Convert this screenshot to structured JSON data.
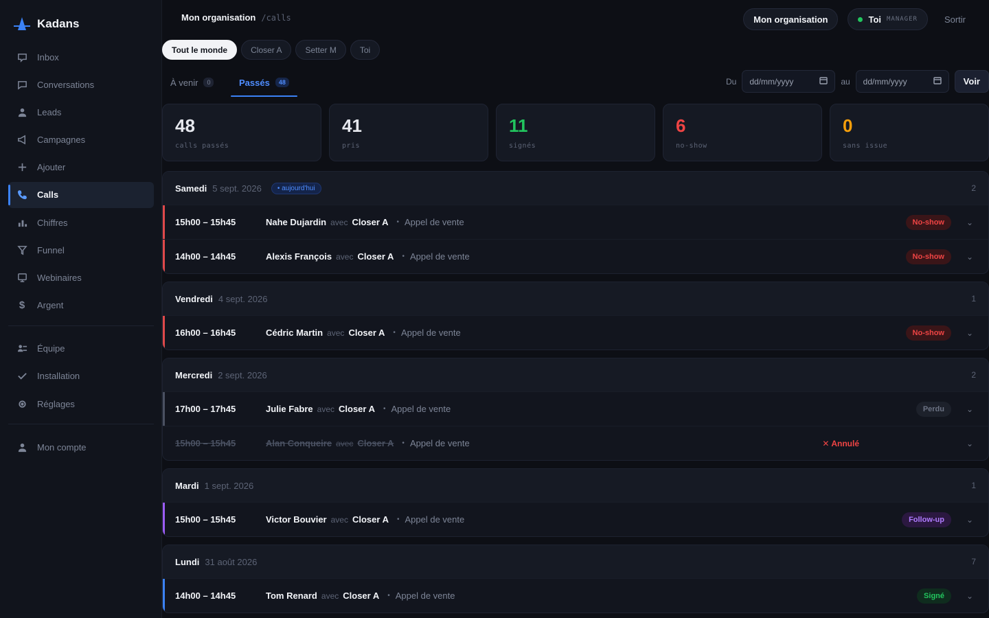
{
  "brand": {
    "name": "Kadans",
    "accent": "#3b82f6"
  },
  "sidebar": {
    "items": [
      {
        "label": "Inbox",
        "icon": "inbox-icon"
      },
      {
        "label": "Conversations",
        "icon": "chat-icon"
      },
      {
        "label": "Leads",
        "icon": "user-icon"
      },
      {
        "label": "Campagnes",
        "icon": "megaphone-icon"
      },
      {
        "label": "Ajouter",
        "icon": "plus-icon"
      },
      {
        "label": "Calls",
        "icon": "phone-icon",
        "active": true
      },
      {
        "label": "Chiffres",
        "icon": "bar-chart-icon"
      },
      {
        "label": "Funnel",
        "icon": "funnel-icon"
      },
      {
        "label": "Webinaires",
        "icon": "monitor-icon"
      },
      {
        "label": "Argent",
        "icon": "dollar-icon"
      }
    ],
    "items2": [
      {
        "label": "Équipe",
        "icon": "team-icon"
      },
      {
        "label": "Installation",
        "icon": "check-icon"
      },
      {
        "label": "Réglages",
        "icon": "gear-icon"
      }
    ],
    "account": {
      "label": "Mon compte",
      "icon": "user-icon"
    }
  },
  "header": {
    "org": "Mon organisation",
    "path": "/calls",
    "org_button": "Mon organisation",
    "user_label": "Toi",
    "user_role": "MANAGER",
    "logout": "Sortir"
  },
  "filters": [
    "Tout le monde",
    "Closer A",
    "Setter M",
    "Toi"
  ],
  "tabs": [
    {
      "label": "À venir",
      "count": "0"
    },
    {
      "label": "Passés",
      "count": "48",
      "active": true
    }
  ],
  "daterange": {
    "from_label": "Du",
    "to_label": "au",
    "placeholder": "dd/mm/yyyy",
    "button": "Voir"
  },
  "stats": [
    {
      "value": "48",
      "label": "calls passés",
      "color": "#e6e8ee"
    },
    {
      "value": "41",
      "label": "pris",
      "color": "#e6e8ee"
    },
    {
      "value": "11",
      "label": "signés",
      "color": "#22c55e"
    },
    {
      "value": "6",
      "label": "no-show",
      "color": "#ef4444"
    },
    {
      "value": "0",
      "label": "sans issue",
      "color": "#f59e0b"
    }
  ],
  "groups": [
    {
      "day": "Samedi",
      "date": "5 sept. 2026",
      "today": "• aujourd'hui",
      "count": "2",
      "rows": [
        {
          "time": "15h00 – 15h45",
          "who": "Nahe Dujardin",
          "with": "avec",
          "closer": "Closer A",
          "kind": "Appel de vente",
          "status": "No-show",
          "status_type": "noshow",
          "bar": "#e0494a"
        },
        {
          "time": "14h00 – 14h45",
          "who": "Alexis François",
          "with": "avec",
          "closer": "Closer A",
          "kind": "Appel de vente",
          "status": "No-show",
          "status_type": "noshow",
          "bar": "#e0494a"
        }
      ]
    },
    {
      "day": "Vendredi",
      "date": "4 sept. 2026",
      "count": "1",
      "rows": [
        {
          "time": "16h00 – 16h45",
          "who": "Cédric Martin",
          "with": "avec",
          "closer": "Closer A",
          "kind": "Appel de vente",
          "status": "No-show",
          "status_type": "noshow",
          "bar": "#e0494a"
        }
      ]
    },
    {
      "day": "Mercredi",
      "date": "2 sept. 2026",
      "count": "2",
      "rows": [
        {
          "time": "17h00 – 17h45",
          "who": "Julie Fabre",
          "with": "avec",
          "closer": "Closer A",
          "kind": "Appel de vente",
          "status": "Perdu",
          "status_type": "perdu",
          "bar": "#4b5161"
        },
        {
          "time": "15h00 – 15h45",
          "who": "Alan Conqueire",
          "with": "avec",
          "closer": "Closer A",
          "kind": "Appel de vente",
          "status": "✕ Annulé",
          "status_type": "annule",
          "bar": "",
          "cancelled": true
        }
      ]
    },
    {
      "day": "Mardi",
      "date": "1 sept. 2026",
      "count": "1",
      "rows": [
        {
          "time": "15h00 – 15h45",
          "who": "Victor Bouvier",
          "with": "avec",
          "closer": "Closer A",
          "kind": "Appel de vente",
          "status": "Follow-up",
          "status_type": "follow",
          "bar": "#9b5cf6"
        }
      ]
    },
    {
      "day": "Lundi",
      "date": "31 août 2026",
      "count": "7",
      "rows": [
        {
          "time": "14h00 – 14h45",
          "who": "Tom Renard",
          "with": "avec",
          "closer": "Closer A",
          "kind": "Appel de vente",
          "status": "Signé",
          "status_type": "signe",
          "bar": "#3b82f6"
        }
      ]
    }
  ]
}
